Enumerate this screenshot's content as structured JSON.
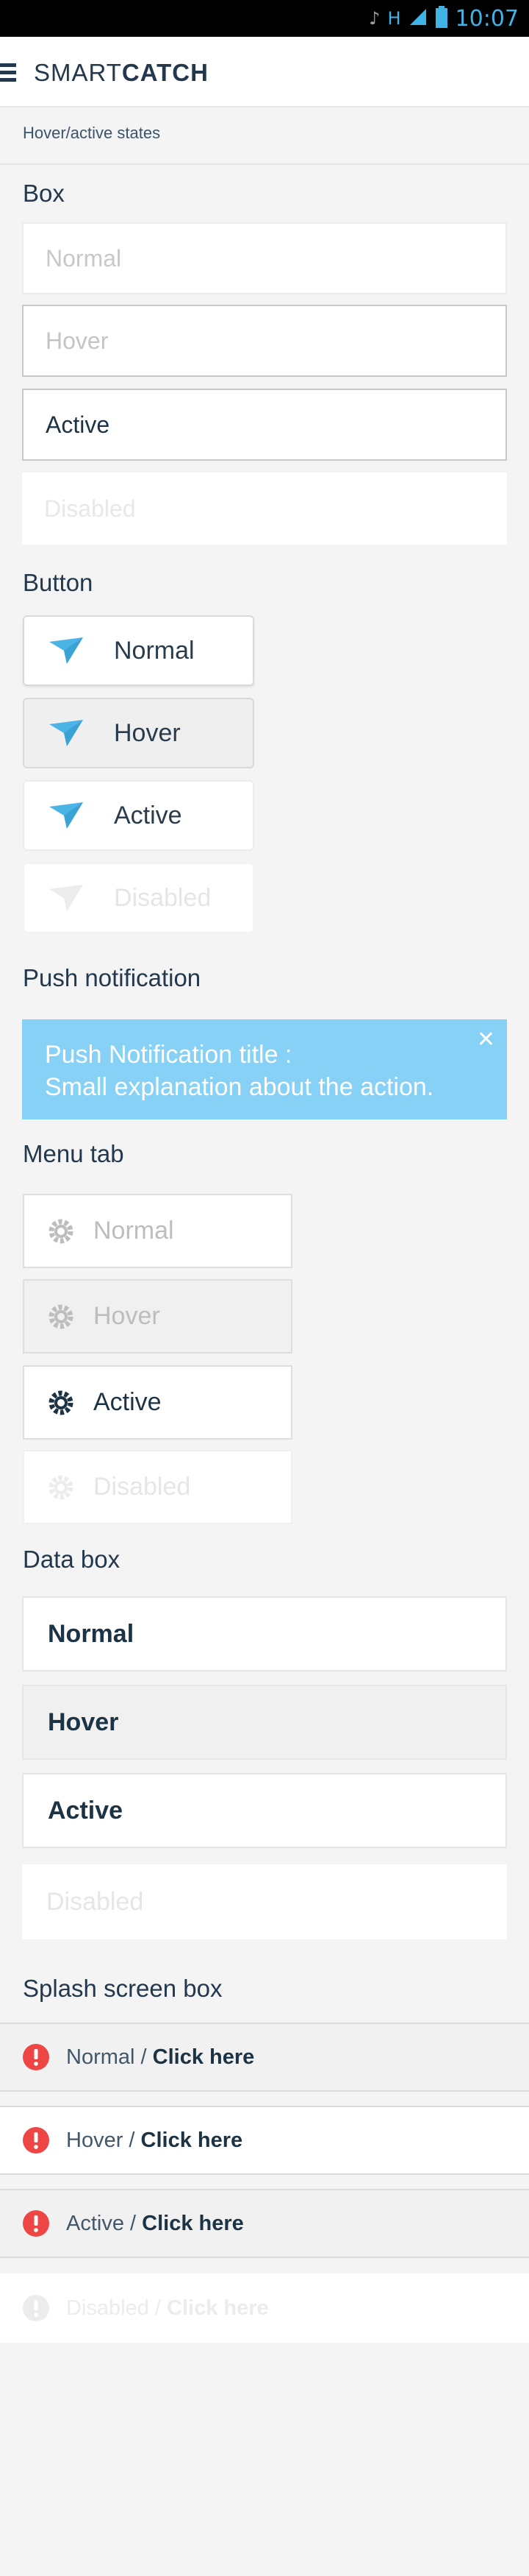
{
  "status_bar": {
    "time": "10:07",
    "network_label": "H"
  },
  "header": {
    "logo_thin": "SMART",
    "logo_bold": "CATCH"
  },
  "breadcrumb": "Hover/active states",
  "sections": {
    "box": {
      "title": "Box",
      "states": [
        "Normal",
        "Hover",
        "Active",
        "Disabled"
      ]
    },
    "button": {
      "title": "Button",
      "states": [
        "Normal",
        "Hover",
        "Active",
        "Disabled"
      ]
    },
    "push": {
      "title": "Push notification",
      "line1": "Push Notification title :",
      "line2": "Small explanation about the action.",
      "close": "✕"
    },
    "menu_tab": {
      "title": "Menu tab",
      "states": [
        "Normal",
        "Hover",
        "Active",
        "Disabled"
      ]
    },
    "data_box": {
      "title": "Data box",
      "states": [
        "Normal",
        "Hover",
        "Active",
        "Disabled"
      ]
    },
    "splash": {
      "title": "Splash screen box",
      "rows": [
        {
          "state": "Normal /",
          "link": "Click here"
        },
        {
          "state": "Hover /",
          "link": "Click here"
        },
        {
          "state": "Active /",
          "link": "Click here"
        },
        {
          "state": "Disabled /",
          "link": "Click here"
        }
      ]
    }
  },
  "colors": {
    "brand_dark": "#23384d",
    "accent_blue": "#86d1f5",
    "plane_blue": "#4bb4e6",
    "alert_red": "#ee4545"
  }
}
